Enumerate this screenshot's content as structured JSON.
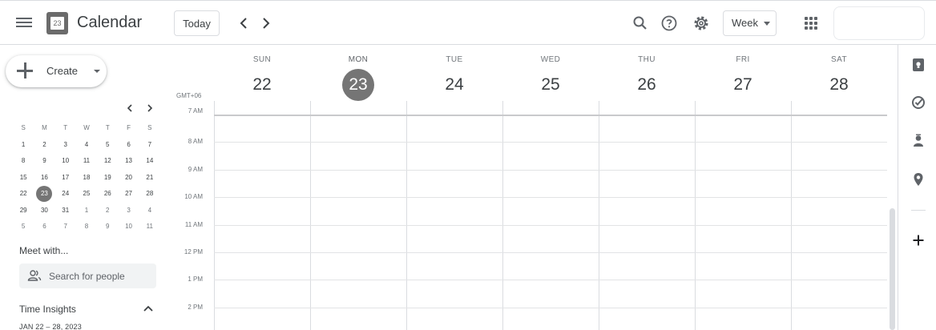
{
  "header": {
    "logo_day": "23",
    "app_title": "Calendar",
    "today_label": "Today",
    "prev_icon": "chevron-left-icon",
    "next_icon": "chevron-right-icon",
    "view_label": "Week"
  },
  "sidebar": {
    "create_label": "Create",
    "mini_calendar": {
      "weekdays": [
        "S",
        "M",
        "T",
        "W",
        "T",
        "F",
        "S"
      ],
      "weeks": [
        [
          "1",
          "2",
          "3",
          "4",
          "5",
          "6",
          "7"
        ],
        [
          "8",
          "9",
          "10",
          "11",
          "12",
          "13",
          "14"
        ],
        [
          "15",
          "16",
          "17",
          "18",
          "19",
          "20",
          "21"
        ],
        [
          "22",
          "23",
          "24",
          "25",
          "26",
          "27",
          "28"
        ],
        [
          "29",
          "30",
          "31",
          "1",
          "2",
          "3",
          "4"
        ],
        [
          "5",
          "6",
          "7",
          "8",
          "9",
          "10",
          "11"
        ]
      ],
      "selected": "23"
    },
    "meet_title": "Meet with...",
    "people_search_placeholder": "Search for people",
    "insights_title": "Time Insights",
    "insights_range": "JAN 22 – 28, 2023"
  },
  "week": {
    "timezone": "GMT+06",
    "days": [
      {
        "name": "SUN",
        "num": "22"
      },
      {
        "name": "MON",
        "num": "23",
        "active": true
      },
      {
        "name": "TUE",
        "num": "24"
      },
      {
        "name": "WED",
        "num": "25"
      },
      {
        "name": "THU",
        "num": "26"
      },
      {
        "name": "FRI",
        "num": "27"
      },
      {
        "name": "SAT",
        "num": "28"
      }
    ],
    "hours": [
      "7 AM",
      "8 AM",
      "9 AM",
      "10 AM",
      "11 AM",
      "12 PM",
      "1 PM",
      "2 PM"
    ]
  },
  "right_panel": {
    "icons": [
      "keep-icon",
      "tasks-icon",
      "contacts-icon",
      "maps-icon",
      "add-icon"
    ]
  },
  "colors": {
    "accent": "#757575",
    "border": "#dadce0",
    "text": "#3c4043"
  }
}
